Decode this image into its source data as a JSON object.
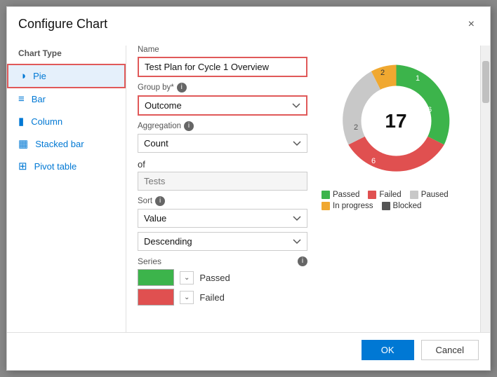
{
  "dialog": {
    "title": "Configure Chart",
    "close_label": "×"
  },
  "sidebar": {
    "label": "Chart Type",
    "items": [
      {
        "id": "pie",
        "label": "Pie",
        "icon": "🥧",
        "active": true
      },
      {
        "id": "bar",
        "label": "Bar",
        "icon": "▤",
        "active": false
      },
      {
        "id": "column",
        "label": "Column",
        "icon": "📊",
        "active": false
      },
      {
        "id": "stacked-bar",
        "label": "Stacked bar",
        "icon": "▦",
        "active": false
      },
      {
        "id": "pivot-table",
        "label": "Pivot table",
        "icon": "⊞",
        "active": false
      }
    ]
  },
  "form": {
    "name_label": "Name",
    "name_value": "Test Plan for Cycle 1 Overview",
    "group_by_label": "Group by*",
    "group_by_value": "Outcome",
    "aggregation_label": "Aggregation",
    "aggregation_value": "Count",
    "of_label": "of",
    "of_placeholder": "Tests",
    "sort_label": "Sort",
    "sort_value": "Value",
    "sort_order_value": "Descending",
    "series_label": "Series",
    "series_items": [
      {
        "color": "green",
        "label": "Passed"
      },
      {
        "color": "red",
        "label": "Failed"
      }
    ]
  },
  "chart": {
    "center_value": "17",
    "segments": [
      {
        "label": "Passed",
        "color": "#3cb44b",
        "value": 6,
        "percent": 35
      },
      {
        "label": "Failed",
        "color": "#e05050",
        "value": 6,
        "percent": 35
      },
      {
        "label": "Paused",
        "color": "#c8c8c8",
        "value": 2,
        "percent": 12
      },
      {
        "label": "In progress",
        "color": "#f0a830",
        "value": 2,
        "percent": 12
      },
      {
        "label": "Blocked",
        "color": "#555555",
        "value": 1,
        "percent": 6
      }
    ],
    "legend": [
      {
        "label": "Passed",
        "color": "#3cb44b"
      },
      {
        "label": "Failed",
        "color": "#e05050"
      },
      {
        "label": "Paused",
        "color": "#c8c8c8"
      },
      {
        "label": "In progress",
        "color": "#f0a830"
      },
      {
        "label": "Blocked",
        "color": "#555555"
      }
    ]
  },
  "footer": {
    "ok_label": "OK",
    "cancel_label": "Cancel"
  }
}
